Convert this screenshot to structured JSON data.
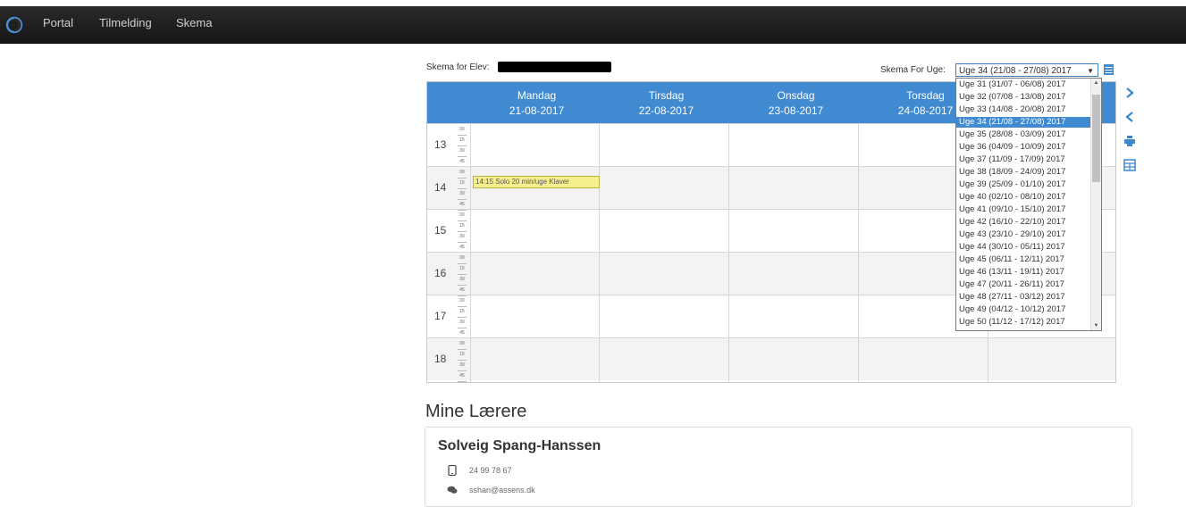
{
  "nav": {
    "items": [
      "Portal",
      "Tilmelding",
      "Skema"
    ]
  },
  "schedule": {
    "elev_label": "Skema for Elev:",
    "uge_label": "Skema For Uge:",
    "uge_selected": "Uge 34 (21/08 - 27/08) 2017",
    "days": [
      {
        "name": "Mandag",
        "date": "21-08-2017"
      },
      {
        "name": "Tirsdag",
        "date": "22-08-2017"
      },
      {
        "name": "Onsdag",
        "date": "23-08-2017"
      },
      {
        "name": "Torsdag",
        "date": "24-08-2017"
      }
    ],
    "hours": [
      "13",
      "14",
      "15",
      "16",
      "17",
      "18"
    ],
    "quarters": [
      "00",
      "15",
      "30",
      "45"
    ],
    "event": {
      "text": "14:15 Solo 20 min/uge Klaver"
    }
  },
  "week_options": [
    "Uge 31 (31/07 - 06/08) 2017",
    "Uge 32 (07/08 - 13/08) 2017",
    "Uge 33 (14/08 - 20/08) 2017",
    "Uge 34 (21/08 - 27/08) 2017",
    "Uge 35 (28/08 - 03/09) 2017",
    "Uge 36 (04/09 - 10/09) 2017",
    "Uge 37 (11/09 - 17/09) 2017",
    "Uge 38 (18/09 - 24/09) 2017",
    "Uge 39 (25/09 - 01/10) 2017",
    "Uge 40 (02/10 - 08/10) 2017",
    "Uge 41 (09/10 - 15/10) 2017",
    "Uge 42 (16/10 - 22/10) 2017",
    "Uge 43 (23/10 - 29/10) 2017",
    "Uge 44 (30/10 - 05/11) 2017",
    "Uge 45 (06/11 - 12/11) 2017",
    "Uge 46 (13/11 - 19/11) 2017",
    "Uge 47 (20/11 - 26/11) 2017",
    "Uge 48 (27/11 - 03/12) 2017",
    "Uge 49 (04/12 - 10/12) 2017",
    "Uge 50 (11/12 - 17/12) 2017"
  ],
  "week_selected_index": 3,
  "teachers": {
    "title": "Mine Lærere",
    "name": "Solveig Spang-Hanssen",
    "phone": "24 99 78 67",
    "email": "sshan@assens.dk"
  },
  "colors": {
    "navbar": "#1f1f1f",
    "accent": "#3f8ad1",
    "event": "#f6f08c"
  },
  "icons": [
    "logo-icon",
    "calendar-icon",
    "chevron-right-icon",
    "chevron-left-icon",
    "print-icon",
    "table-icon",
    "phone-icon",
    "chat-icon"
  ]
}
